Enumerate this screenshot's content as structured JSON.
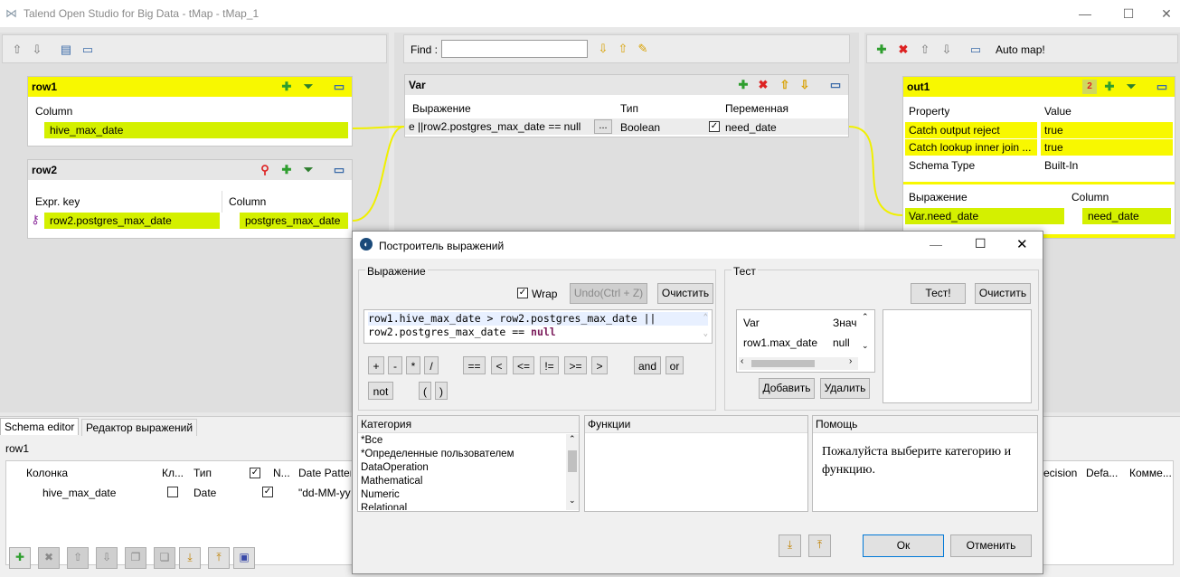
{
  "window": {
    "title": "Talend Open Studio for Big Data - tMap - tMap_1"
  },
  "find": {
    "label": "Find :",
    "value": ""
  },
  "rows": {
    "row1": {
      "name": "row1",
      "col_header": "Column",
      "column": "hive_max_date"
    },
    "row2": {
      "name": "row2",
      "expr_header": "Expr. key",
      "col_header": "Column",
      "expr": "row2.postgres_max_date",
      "column": "postgres_max_date"
    }
  },
  "var": {
    "name": "Var",
    "headers": {
      "expr": "Выражение",
      "type": "Тип",
      "var": "Переменная"
    },
    "row": {
      "expr": "e ||row2.postgres_max_date == null",
      "dots": "...",
      "type": "Boolean",
      "var": "need_date"
    }
  },
  "out": {
    "toolbar_automap": "Auto map!",
    "name": "out1",
    "badge": "2",
    "prop_headers": {
      "property": "Property",
      "value": "Value"
    },
    "props": [
      {
        "property": "Catch output reject",
        "value": "true"
      },
      {
        "property": "Catch lookup inner join ...",
        "value": "true"
      },
      {
        "property": "Schema Type",
        "value": "Built-In"
      }
    ],
    "headers": {
      "expr": "Выражение",
      "col": "Column"
    },
    "row": {
      "expr": "Var.need_date",
      "col": "need_date"
    }
  },
  "schema": {
    "tabs": [
      "Schema editor",
      "Редактор выражений"
    ],
    "label": "row1",
    "headers": [
      "Колонка",
      "Кл...",
      "Тип",
      "N...",
      "Date Patter",
      "ecision",
      "Defa...",
      "Комме..."
    ],
    "row": {
      "col": "hive_max_date",
      "type": "Date",
      "pattern": "\"dd-MM-yy"
    }
  },
  "dialog": {
    "title": "Построитель выражений",
    "expr_group": "Выражение",
    "wrap_label": "Wrap",
    "undo": "Undo(Ctrl + Z)",
    "clear": "Очистить",
    "code_line1": "row1.hive_max_date > row2.postgres_max_date  ||",
    "code_line2a": "row2.postgres_max_date == ",
    "code_line2b": "null",
    "ops_row1": [
      "+",
      "-",
      "*",
      "/",
      "==",
      "<",
      "<=",
      "!=",
      ">=",
      ">",
      "and",
      "or"
    ],
    "ops_row2": [
      "not",
      "(",
      ")"
    ],
    "test_group": "Тест",
    "test_btn": "Тест!",
    "test_clear": "Очистить",
    "test_table": {
      "h1": "Var",
      "h2": "Знач",
      "r1c1": "row1.max_date",
      "r1c2": "null"
    },
    "add": "Добавить",
    "remove": "Удалить",
    "category_header": "Категория",
    "categories": [
      "*Все",
      "*Определенные пользователем",
      "DataOperation",
      "Mathematical",
      "Numeric",
      "Relational"
    ],
    "functions_header": "Функции",
    "help_header": "Помощь",
    "help_text": "Пожалуйста выберите категорию и функцию.",
    "ok": "Ок",
    "cancel": "Отменить"
  }
}
